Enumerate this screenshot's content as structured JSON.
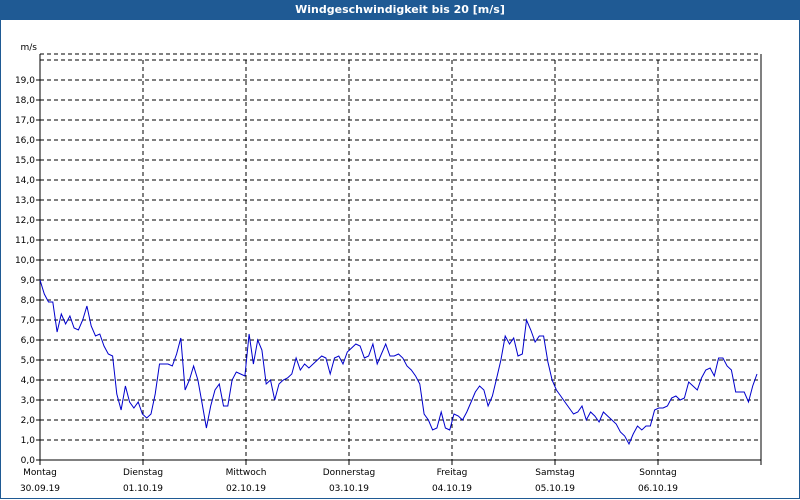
{
  "window": {
    "title": "Windgeschwindigkeit bis 20 [m/s]"
  },
  "colors": {
    "title_bar": "#1f5a94",
    "line": "#0000cc",
    "grid": "#000000"
  },
  "chart_data": {
    "type": "line",
    "title": "Windgeschwindigkeit bis 20 [m/s]",
    "ylabel": "m/s",
    "ylim": [
      0,
      20
    ],
    "grid": true,
    "y_ticks": [
      "0,0",
      "1,0",
      "2,0",
      "3,0",
      "4,0",
      "5,0",
      "6,0",
      "7,0",
      "8,0",
      "9,0",
      "10,0",
      "11,0",
      "12,0",
      "13,0",
      "14,0",
      "15,0",
      "16,0",
      "17,0",
      "18,0",
      "19,0"
    ],
    "x_ticks": [
      {
        "day": "Montag",
        "date": "30.09.19"
      },
      {
        "day": "Dienstag",
        "date": "01.10.19"
      },
      {
        "day": "Mittwoch",
        "date": "02.10.19"
      },
      {
        "day": "Donnerstag",
        "date": "03.10.19"
      },
      {
        "day": "Freitag",
        "date": "04.10.19"
      },
      {
        "day": "Samstag",
        "date": "05.10.19"
      },
      {
        "day": "Sonntag",
        "date": "06.10.19"
      }
    ],
    "series": [
      {
        "values": [
          9.0,
          8.3,
          7.9,
          7.9,
          6.4,
          7.3,
          6.8,
          7.2,
          6.6,
          6.5,
          7.0,
          7.7,
          6.7,
          6.2,
          6.3,
          5.7,
          5.3,
          5.2,
          3.3,
          2.5,
          3.7,
          2.9,
          2.6,
          2.9,
          2.3,
          2.1,
          2.3,
          3.3,
          4.8,
          4.8,
          4.8,
          4.7,
          5.3,
          6.1,
          3.5,
          4.0,
          4.7,
          4.0,
          2.8,
          1.6,
          2.7,
          3.5,
          3.8,
          2.7,
          2.7,
          4.0,
          4.4,
          4.3,
          4.2,
          6.3,
          4.8,
          6.0,
          5.5,
          3.8,
          4.0,
          3.0,
          3.8,
          4.0,
          4.1,
          4.3,
          5.1,
          4.5,
          4.8,
          4.6,
          4.8,
          5.0,
          5.2,
          5.1,
          4.3,
          5.1,
          5.2,
          4.8,
          5.4,
          5.6,
          5.8,
          5.7,
          5.1,
          5.2,
          5.8,
          4.8,
          5.3,
          5.8,
          5.2,
          5.2,
          5.3,
          5.1,
          4.7,
          4.5,
          4.2,
          3.8,
          2.3,
          2.0,
          1.5,
          1.6,
          2.4,
          1.6,
          1.5,
          2.3,
          2.2,
          2.0,
          2.4,
          2.9,
          3.4,
          3.7,
          3.5,
          2.7,
          3.2,
          4.1,
          5.0,
          6.2,
          5.8,
          6.1,
          5.2,
          5.3,
          7.0,
          6.5,
          5.9,
          6.2,
          6.2,
          4.9,
          4.0,
          3.5,
          3.2,
          2.9,
          2.6,
          2.3,
          2.4,
          2.7,
          2.0,
          2.4,
          2.2,
          1.9,
          2.4,
          2.2,
          2.0,
          1.8,
          1.4,
          1.2,
          0.8,
          1.3,
          1.7,
          1.5,
          1.7,
          1.7,
          2.5,
          2.6,
          2.6,
          2.7,
          3.1,
          3.2,
          3.0,
          3.1,
          3.9,
          3.7,
          3.5,
          4.1,
          4.5,
          4.6,
          4.2,
          5.1,
          5.1,
          4.7,
          4.5,
          3.4,
          3.4,
          3.4,
          2.9,
          3.7,
          4.3
        ]
      }
    ]
  }
}
